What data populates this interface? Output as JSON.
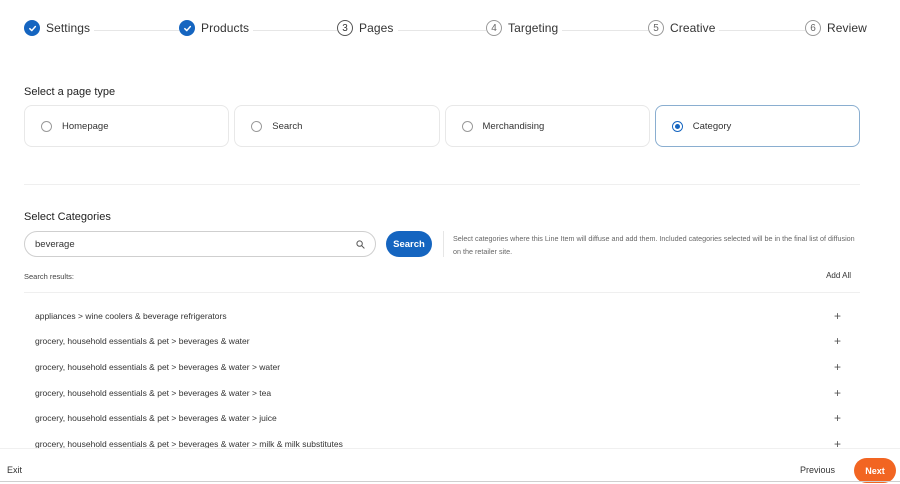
{
  "stepper": {
    "steps": [
      {
        "number": "1",
        "label": "Settings",
        "state": "done"
      },
      {
        "number": "2",
        "label": "Products",
        "state": "done"
      },
      {
        "number": "3",
        "label": "Pages",
        "state": "current"
      },
      {
        "number": "4",
        "label": "Targeting",
        "state": "future"
      },
      {
        "number": "5",
        "label": "Creative",
        "state": "future"
      },
      {
        "number": "6",
        "label": "Review",
        "state": "future"
      }
    ]
  },
  "page_type": {
    "title": "Select a page type",
    "options": [
      {
        "label": "Homepage",
        "selected": false
      },
      {
        "label": "Search",
        "selected": false
      },
      {
        "label": "Merchandising",
        "selected": false
      },
      {
        "label": "Category",
        "selected": true
      }
    ]
  },
  "categories": {
    "title": "Select Categories",
    "search_value": "beverage",
    "search_button": "Search",
    "help_text": "Select categories where this Line Item will diffuse and add them. Included categories selected will be in the final list of diffusion on the retailer site.",
    "results_label": "Search results:",
    "add_all": "Add All",
    "results": [
      "appliances > wine coolers & beverage refrigerators",
      "grocery, household essentials & pet > beverages & water",
      "grocery, household essentials & pet > beverages & water > water",
      "grocery, household essentials & pet > beverages & water > tea",
      "grocery, household essentials & pet > beverages & water > juice",
      "grocery, household essentials & pet > beverages & water > milk & milk substitutes"
    ],
    "add_symbol": "+"
  },
  "footer": {
    "exit": "Exit",
    "previous": "Previous",
    "next": "Next"
  },
  "colors": {
    "primary": "#1565c0",
    "next": "#f26522"
  }
}
